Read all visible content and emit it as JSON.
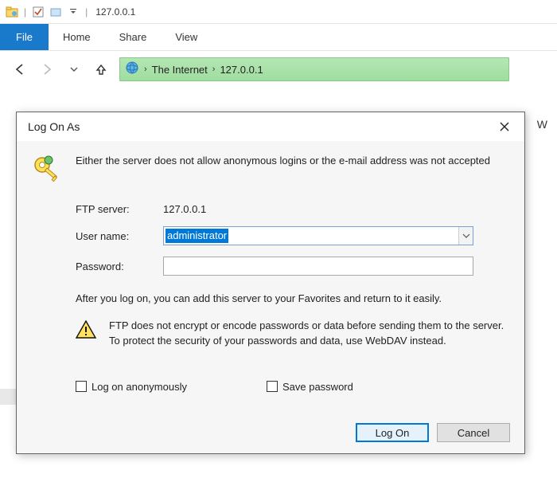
{
  "titlebar": {
    "title": "127.0.0.1"
  },
  "ribbon": {
    "file": "File",
    "home": "Home",
    "share": "Share",
    "view": "View"
  },
  "breadcrumb": {
    "root": "The Internet",
    "path": "127.0.0.1"
  },
  "side_letter": "W",
  "dialog": {
    "title": "Log On As",
    "intro": "Either the server does not allow anonymous logins or the e-mail address was not accepted",
    "server_label": "FTP server:",
    "server_value": "127.0.0.1",
    "user_label": "User name:",
    "user_value": "administrator",
    "pass_label": "Password:",
    "pass_value": "",
    "after_text": "After you log on, you can add this server to your Favorites and return to it easily.",
    "warn_text": "FTP does not encrypt or encode passwords or data before sending them to the server.  To protect the security of your passwords and data, use WebDAV instead.",
    "anon_label": "Log on anonymously",
    "save_label": "Save password",
    "logon_btn": "Log On",
    "cancel_btn": "Cancel"
  }
}
